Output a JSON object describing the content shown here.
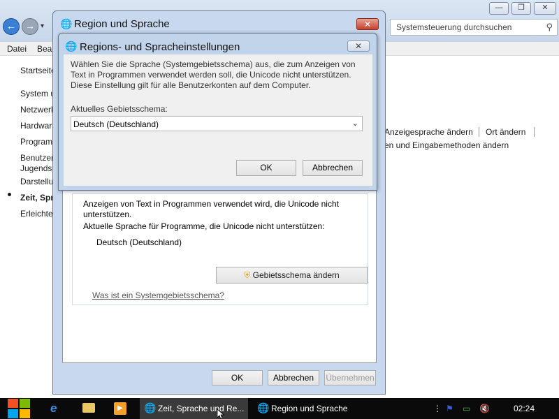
{
  "control_panel": {
    "search_placeholder": "Systemsteuerung durchsuchen",
    "menu": [
      "Datei",
      "Bea"
    ],
    "sidebar": [
      "Startseite",
      "System u",
      "Netzwerk",
      "Hardwar",
      "Program",
      "Benutzer",
      "Jugendsc",
      "Darstellu",
      "Zeit, Spr",
      "Erleichte"
    ],
    "links": {
      "display_language": "Anzeigesprache ändern",
      "location": "Ort ändern",
      "input_methods": "en und Eingabemethoden ändern"
    }
  },
  "region_dialog": {
    "title": "Region und Sprache",
    "close": "✕",
    "text_line1": "Anzeigen von Text in Programmen verwendet wird, die Unicode nicht",
    "text_line2": "unterstützen.",
    "current_language_label": "Aktuelle Sprache für Programme, die Unicode nicht unterstützen:",
    "current_language_value": "Deutsch (Deutschland)",
    "change_locale_button": "Gebietsschema ändern",
    "help_link": "Was ist ein Systemgebietsschema?",
    "buttons": {
      "ok": "OK",
      "cancel": "Abbrechen",
      "apply": "Übernehmen"
    }
  },
  "settings_dialog": {
    "title": "Regions- und Spracheinstellungen",
    "close": "✕",
    "description": [
      "Wählen Sie die Sprache (Systemgebietsschema) aus, die zum Anzeigen von",
      "Text in Programmen verwendet werden soll, die Unicode nicht unterstützen.",
      "Diese Einstellung gilt für alle Benutzerkonten auf dem Computer."
    ],
    "locale_label": "Aktuelles Gebietsschema:",
    "locale_value": "Deutsch (Deutschland)",
    "buttons": {
      "ok": "OK",
      "cancel": "Abbrechen"
    }
  },
  "taskbar": {
    "tasks": [
      "Zeit, Sprache und Re...",
      "Region und Sprache"
    ],
    "clock": "02:24"
  },
  "colors": {
    "accent": "#2763b0",
    "close_red": "#c7402a",
    "taskbar": "#0a0a0a"
  }
}
